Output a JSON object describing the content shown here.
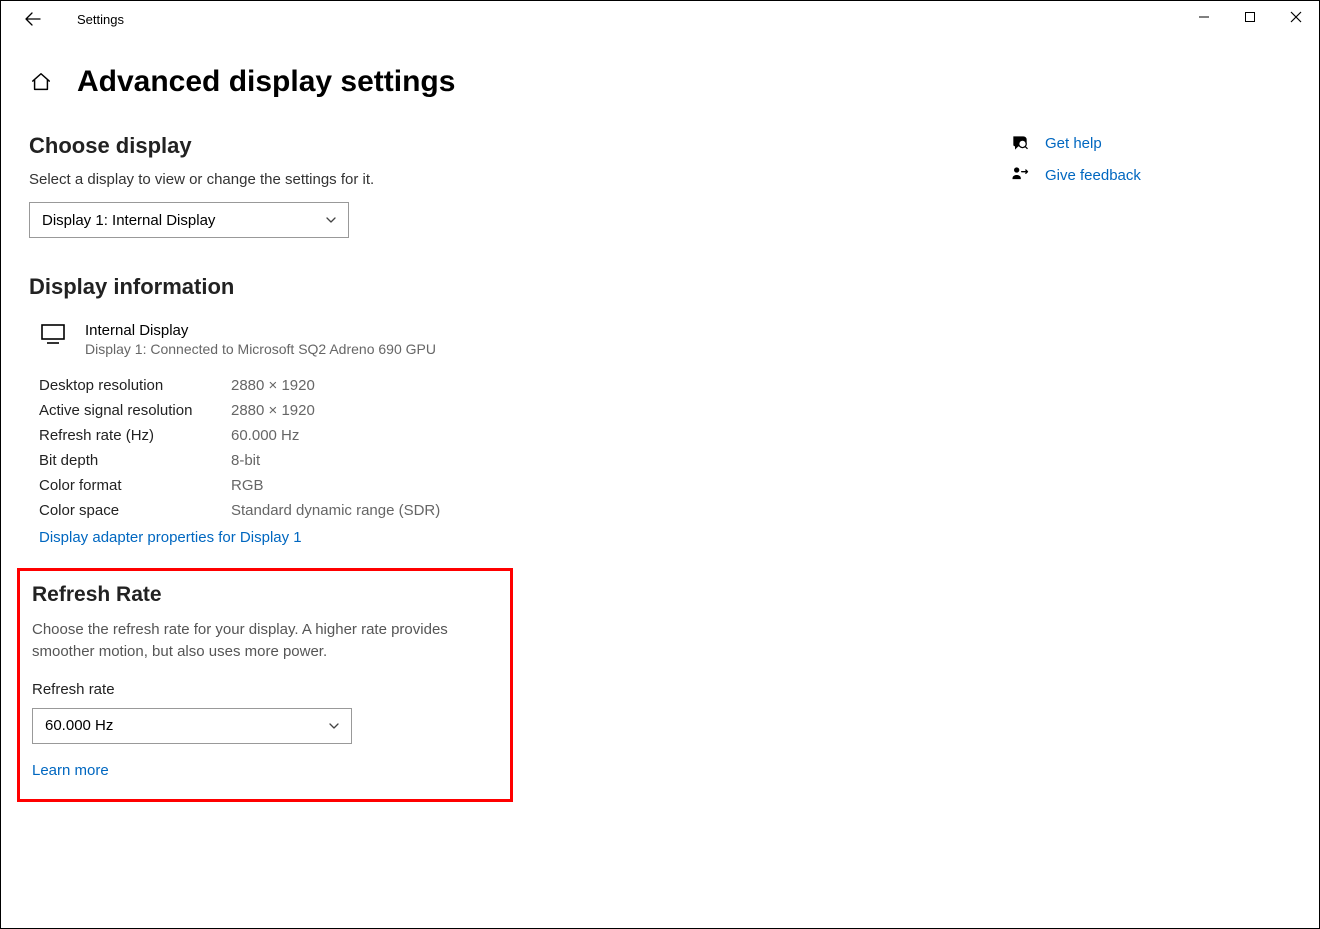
{
  "app_title": "Settings",
  "page_title": "Advanced display settings",
  "choose_display": {
    "heading": "Choose display",
    "desc": "Select a display to view or change the settings for it.",
    "selected": "Display 1: Internal Display"
  },
  "display_info": {
    "heading": "Display information",
    "name": "Internal Display",
    "sub": "Display 1: Connected to Microsoft SQ2 Adreno 690 GPU",
    "rows": [
      {
        "label": "Desktop resolution",
        "value": "2880 × 1920"
      },
      {
        "label": "Active signal resolution",
        "value": "2880 × 1920"
      },
      {
        "label": "Refresh rate (Hz)",
        "value": "60.000 Hz"
      },
      {
        "label": "Bit depth",
        "value": "8-bit"
      },
      {
        "label": "Color format",
        "value": "RGB"
      },
      {
        "label": "Color space",
        "value": "Standard dynamic range (SDR)"
      }
    ],
    "adapter_link": "Display adapter properties for Display 1"
  },
  "refresh_rate": {
    "heading": "Refresh Rate",
    "desc": "Choose the refresh rate for your display. A higher rate provides smoother motion, but also uses more power.",
    "label": "Refresh rate",
    "selected": "60.000 Hz",
    "learn_more": "Learn more"
  },
  "side": {
    "get_help": "Get help",
    "give_feedback": "Give feedback"
  }
}
